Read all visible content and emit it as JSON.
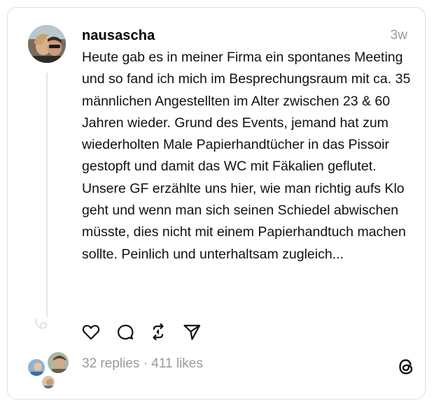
{
  "post": {
    "username": "nausascha",
    "timestamp": "3w",
    "text": "Heute gab es in meiner Firma ein spontanes Meeting und so fand ich mich im Besprechungsraum mit ca. 35 männlichen Angestellten im Alter zwischen 23 & 60 Jahren wieder. Grund des Events, jemand hat zum wiederholten Male Papierhandtücher in das Pissoir gestopft und damit das WC mit Fäkalien geflutet. Unsere GF erzählte uns hier, wie man richtig aufs Klo geht und wenn man sich seinen Schiedel abwischen müsste, dies nicht mit einem Papierhandtuch machen sollte. Peinlich und unterhaltsam zugleich..."
  },
  "actions": [
    {
      "icon": "heart-icon"
    },
    {
      "icon": "comment-icon"
    },
    {
      "icon": "repost-icon"
    },
    {
      "icon": "share-icon"
    }
  ],
  "stats": {
    "replies": "32 replies",
    "separator": " · ",
    "likes": "411 likes"
  },
  "brand": {
    "icon": "threads-logo-icon"
  }
}
